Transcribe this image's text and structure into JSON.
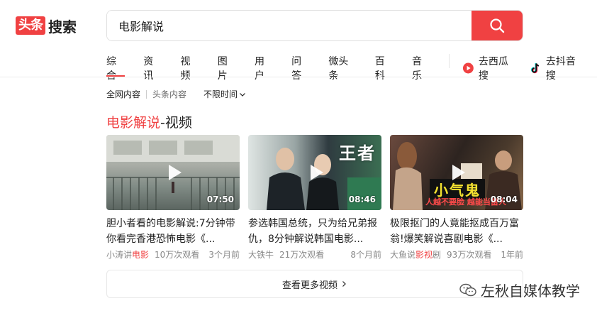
{
  "logo": {
    "badge": "头条",
    "text": "搜索"
  },
  "search": {
    "value": "电影解说"
  },
  "tabs": [
    "综合",
    "资讯",
    "视频",
    "图片",
    "用户",
    "问答",
    "微头条",
    "百科",
    "音乐"
  ],
  "ext_links": [
    {
      "label": "去西瓜搜",
      "icon": "xigua-icon"
    },
    {
      "label": "去抖音搜",
      "icon": "douyin-icon"
    }
  ],
  "filters": {
    "all": "全网内容",
    "toutiao": "头条内容",
    "time": "不限时间"
  },
  "section": {
    "highlight": "电影解说",
    "rest": "-视频"
  },
  "cards": [
    {
      "duration": "07:50",
      "title": "胆小者看的电影解说:7分钟带你看完香港恐怖电影《...",
      "source": "小涛讲",
      "source_hl": "电影",
      "views": "10万次观看",
      "time": "3个月前"
    },
    {
      "duration": "08:46",
      "title": "参选韩国总统，只为给兄弟报仇，8分钟解说韩国电影...",
      "source": "大铁牛",
      "source_hl": "",
      "views": "21万次观看",
      "time": "8个月前",
      "overlay": "王者"
    },
    {
      "duration": "08:04",
      "title": "极限抠门的人竟能抠成百万富翁!爆笑解说喜剧电影《...",
      "source": "大鱼说",
      "source_hl": "影视",
      "source_tail": "剧",
      "views": "93万次观看",
      "time": "1年前",
      "sticker": "小气鬼",
      "sticker_sub": "人越不要脸 越能当富人"
    }
  ],
  "more": {
    "label": "查看更多视频"
  },
  "watermark": {
    "text": "左秋自媒体教学"
  },
  "colors": {
    "accent": "#f04142"
  }
}
